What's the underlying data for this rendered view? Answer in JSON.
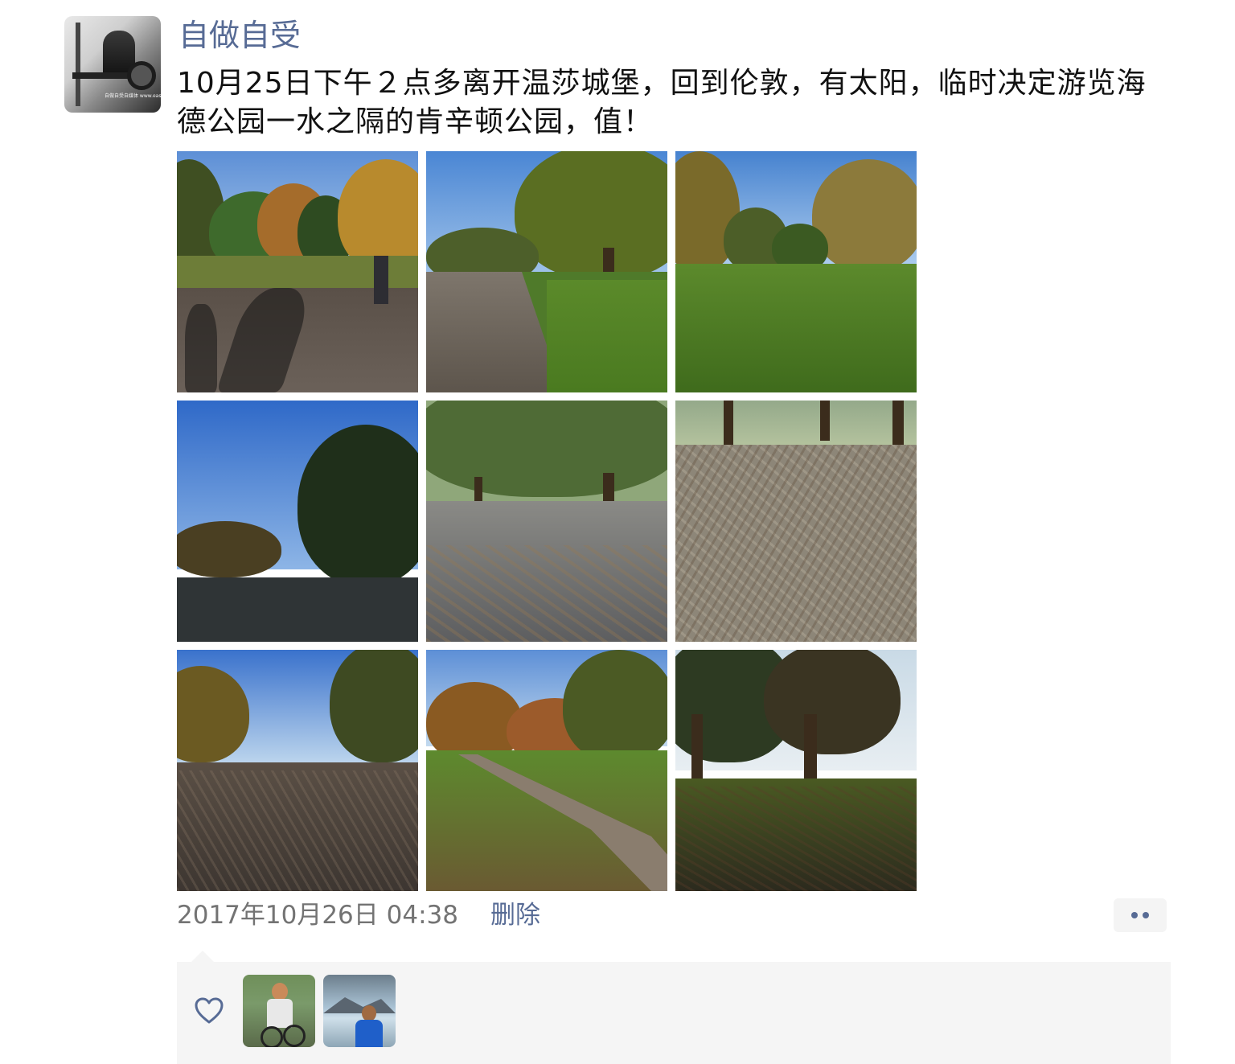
{
  "post": {
    "username": "自做自受",
    "text": "10月25日下午２点多离开温莎城堡，回到伦敦，有太阳，临时决定游览海德公园一水之隔的肯辛顿公园，值！",
    "avatar_caption": "自做自受自媒体 www.easybright.com",
    "photos": [
      {
        "alt": "photo-1"
      },
      {
        "alt": "photo-2"
      },
      {
        "alt": "photo-3"
      },
      {
        "alt": "photo-4"
      },
      {
        "alt": "photo-5"
      },
      {
        "alt": "photo-6"
      },
      {
        "alt": "photo-7"
      },
      {
        "alt": "photo-8"
      },
      {
        "alt": "photo-9"
      }
    ],
    "timestamp": "2017年10月26日 04:38",
    "delete_label": "删除",
    "more_icon": "more-dots-icon"
  },
  "likes": {
    "icon": "heart-icon",
    "likers": [
      {
        "name": "liker-1"
      },
      {
        "name": "liker-2"
      }
    ]
  },
  "colors": {
    "link": "#576b95",
    "text": "#111111",
    "timestamp": "#737373",
    "likes_bg": "#f5f5f5"
  }
}
